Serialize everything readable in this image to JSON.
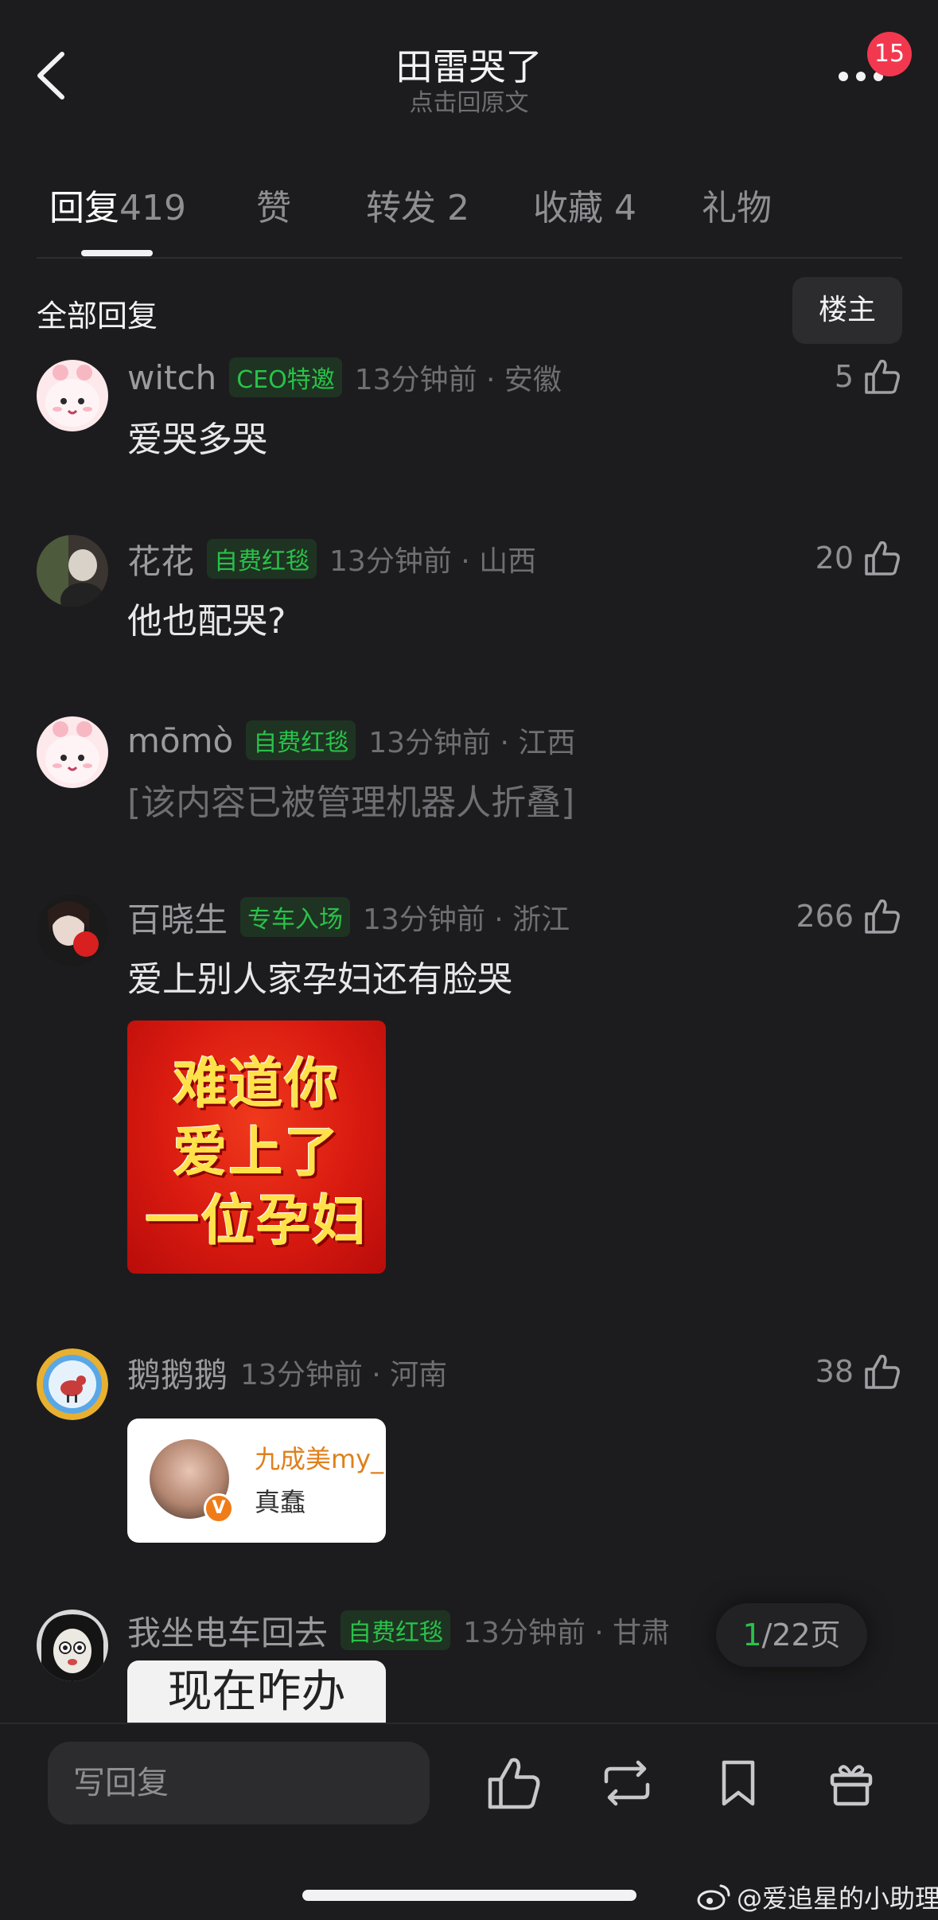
{
  "header": {
    "title": "田雷哭了",
    "subtitle": "点击回原文",
    "notification_count": "15"
  },
  "tabs": [
    {
      "label": "回复",
      "count": "419",
      "active": true
    },
    {
      "label": "赞",
      "count": ""
    },
    {
      "label": "转发",
      "count": "2"
    },
    {
      "label": "收藏",
      "count": "4"
    },
    {
      "label": "礼物",
      "count": ""
    }
  ],
  "filter": {
    "section_title": "全部回复",
    "owner_button": "楼主"
  },
  "comments": [
    {
      "username": "witch",
      "tag": "CEO特邀",
      "time_location": "13分钟前 · 安徽",
      "likes": "5",
      "text": "爱哭多哭"
    },
    {
      "username": "花花",
      "tag": "自费红毯",
      "time_location": "13分钟前 · 山西",
      "likes": "20",
      "text": "他也配哭?"
    },
    {
      "username": "mōmò",
      "tag": "自费红毯",
      "time_location": "13分钟前 · 江西",
      "likes": "",
      "text": "[该内容已被管理机器人折叠]"
    },
    {
      "username": "百晓生",
      "tag": "专车入场",
      "time_location": "13分钟前 · 浙江",
      "likes": "266",
      "text": "爱上别人家孕妇还有脸哭",
      "sticker_lines": [
        "难道你",
        "爱上了",
        "一位孕妇"
      ]
    },
    {
      "username": "鹅鹅鹅",
      "tag": "",
      "time_location": "13分钟前 · 河南",
      "likes": "38",
      "text": "",
      "card": {
        "name": "九成美my_",
        "text": "真蠢",
        "verified": "V"
      }
    },
    {
      "username": "我坐电车回去",
      "tag": "自费红毯",
      "time_location": "13分钟前 · 甘肃",
      "likes": "",
      "text": "",
      "sticker_text": "现在咋办"
    }
  ],
  "pagination": {
    "current": "1",
    "total": "/22页"
  },
  "bottom_bar": {
    "reply_placeholder": "写回复"
  },
  "watermark": "@爱追星的小助理",
  "colors": {
    "background": "#1c1c1e",
    "accent_green": "#29c24a",
    "badge_red": "#f2384f"
  }
}
